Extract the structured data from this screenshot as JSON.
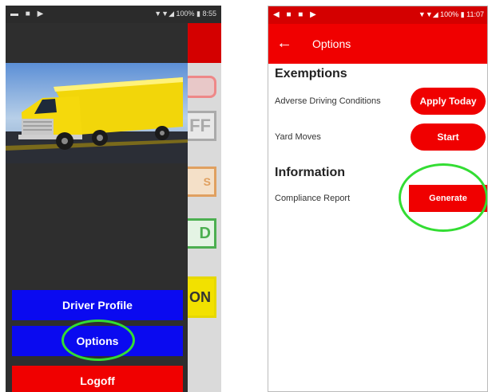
{
  "left_phone": {
    "status_left": "▬ ■ ▶",
    "status_right": "▼▼◢ 100% ▮ 8:55",
    "background_app": {
      "button2_text": "FF",
      "button3_text": "S",
      "button4_text": "D",
      "button5_text": "ON"
    },
    "drawer": {
      "driver_profile": "Driver Profile",
      "options": "Options",
      "logoff": "Logoff"
    }
  },
  "right_phone": {
    "status_left": "◀ ■ ■ ▶",
    "status_right": "▼▼◢ 100% ▮ 11:07",
    "appbar": {
      "back_icon": "←",
      "title": "Options"
    },
    "exemptions": {
      "title": "Exemptions",
      "adverse_label": "Adverse Driving Conditions",
      "adverse_button": "Apply Today",
      "yard_label": "Yard Moves",
      "yard_button": "Start"
    },
    "information": {
      "title": "Information",
      "compliance_label": "Compliance Report",
      "compliance_button": "Generate"
    }
  },
  "colors": {
    "brand_red": "#f00000",
    "menu_blue": "#0a0af0",
    "highlight_green": "#33dd33"
  }
}
